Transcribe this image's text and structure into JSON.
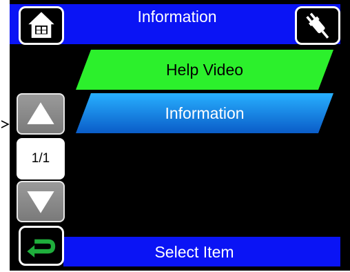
{
  "header": {
    "title": "Information"
  },
  "menu": {
    "items": [
      {
        "label": "Help Video",
        "state": "selected",
        "color": "#2cf02c"
      },
      {
        "label": "Information",
        "state": "normal",
        "color": "#1a8ee8"
      }
    ]
  },
  "pager": {
    "page_indicator": "1/1"
  },
  "footer": {
    "status": "Select Item"
  },
  "icons": {
    "home": "home-icon",
    "plug": "plug-icon",
    "up": "arrow-up-icon",
    "down": "arrow-down-icon",
    "back": "back-arrow-icon"
  },
  "colors": {
    "bar_blue": "#0a14f5",
    "screen_bg": "#000000",
    "selected_green": "#2cf02c",
    "item_blue": "#1a8ee8",
    "back_green": "#1fae3c"
  }
}
